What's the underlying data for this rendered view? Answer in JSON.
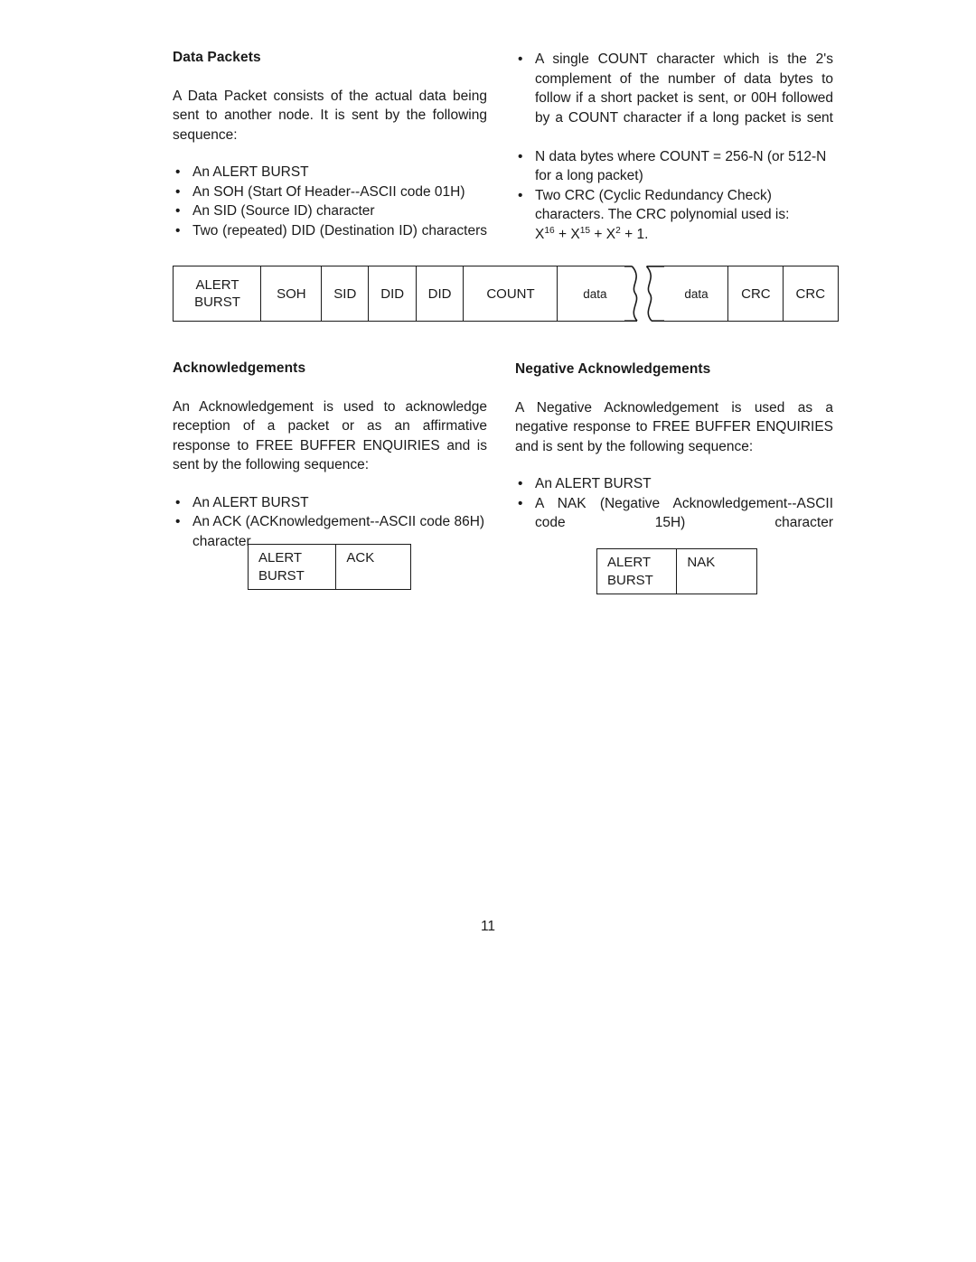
{
  "page": {
    "number": "11"
  },
  "left_column": {
    "section_title": "Data Packets",
    "intro": "A Data Packet consists of the actual data being sent to another node.  It is sent by the following sequence:",
    "bullets": [
      "An ALERT BURST",
      "An SOH (Start Of Header--ASCII  code 01H)",
      "An SID (Source ID) character",
      "Two (repeated) DID (Destination ID) characters"
    ]
  },
  "right_column": {
    "bullets": [
      "A single COUNT character which is the 2's complement of the number of data bytes to follow if a short packet is sent, or 00H followed by a COUNT character if a long packet is sent",
      "N data bytes where COUNT = 256-N (or 512-N for a long packet)",
      "Two CRC (Cyclic Redundancy Check) characters.  The CRC polynomial used is:"
    ],
    "crc_polynomial": {
      "term1_base": "X",
      "term1_exp": "16",
      "plus1": " + ",
      "term2_base": "X",
      "term2_exp": "15",
      "plus2": " + ",
      "term3_base": "X",
      "term3_exp": "2",
      "tail": " + 1."
    }
  },
  "packet_diagram": {
    "cells": [
      {
        "label_line1": "ALERT",
        "label_line2": "BURST"
      },
      {
        "label_line1": "SOH"
      },
      {
        "label_line1": "SID"
      },
      {
        "label_line1": "DID"
      },
      {
        "label_line1": "DID"
      },
      {
        "label_line1": "COUNT"
      },
      {
        "label_line1": "data"
      },
      {
        "label_line1": "data"
      },
      {
        "label_line1": "CRC"
      },
      {
        "label_line1": "CRC"
      }
    ]
  },
  "acknowledgements": {
    "section_title": "Acknowledgements",
    "intro": "An Acknowledgement is used to acknowledge reception of a packet or as an affirmative response to FREE BUFFER ENQUIRIES and is sent by the following sequence:",
    "bullets": [
      "An ALERT BURST",
      "An ACK (ACKnowledgement--ASCII code 86H) character"
    ],
    "diagram": {
      "cell1_line1": "ALERT",
      "cell1_line2": "BURST",
      "cell2_label": "ACK"
    }
  },
  "negative_acknowledgements": {
    "section_title": "Negative Acknowledgements",
    "intro": "A Negative Acknowledgement is used as a negative response to FREE BUFFER ENQUIRIES and is sent by the following sequence:",
    "bullets": [
      "An ALERT BURST",
      "A NAK (Negative Acknowledgement--ASCII code 15H) character"
    ],
    "diagram": {
      "cell1_line1": "ALERT",
      "cell1_line2": "BURST",
      "cell2_label": "NAK"
    }
  },
  "bullet_glyph": "•"
}
